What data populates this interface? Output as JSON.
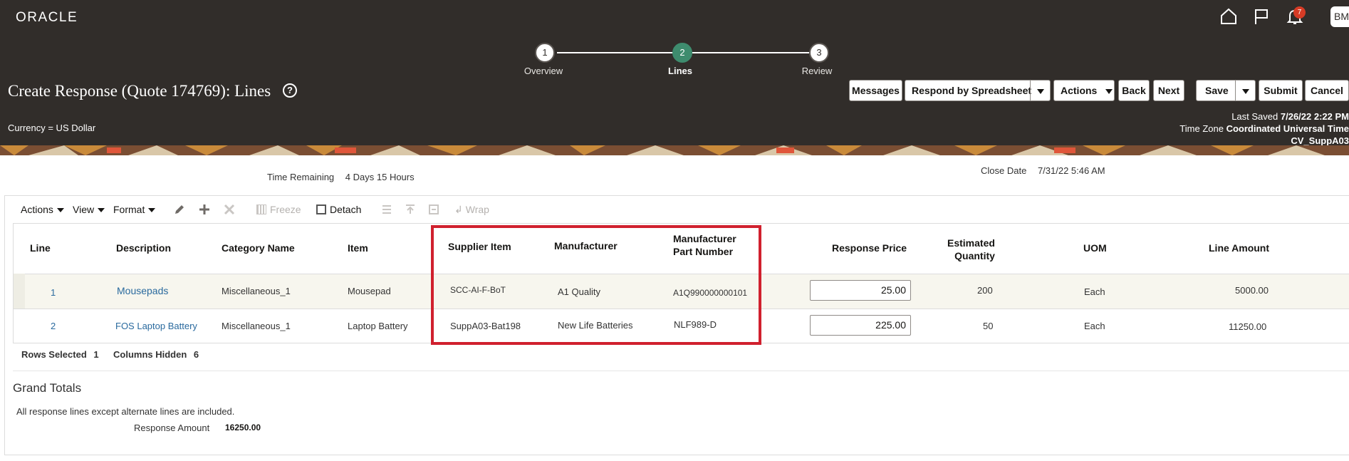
{
  "header": {
    "logo": "ORACLE",
    "notification_count": "7",
    "user_initials": "BM"
  },
  "stepper": [
    {
      "number": "1",
      "label": "Overview",
      "active": false
    },
    {
      "number": "2",
      "label": "Lines",
      "active": true
    },
    {
      "number": "3",
      "label": "Review",
      "active": false
    }
  ],
  "page": {
    "title": "Create Response (Quote 174769): Lines",
    "currency": "Currency = US Dollar"
  },
  "buttons": {
    "messages": "Messages",
    "respond_by_spreadsheet": "Respond by Spreadsheet",
    "actions": "Actions",
    "back": "Back",
    "next": "Next",
    "save": "Save",
    "submit": "Submit",
    "cancel": "Cancel"
  },
  "saved_info": {
    "last_saved_label": "Last Saved",
    "last_saved_value": "7/26/22 2:22 PM",
    "time_zone_label": "Time Zone",
    "time_zone_value": "Coordinated Universal Time",
    "supplier": "CV_SuppA03"
  },
  "info": {
    "time_remaining_label": "Time Remaining",
    "time_remaining_value": "4 Days 15 Hours",
    "close_date_label": "Close Date",
    "close_date_value": "7/31/22 5:46 AM"
  },
  "toolbar": {
    "actions": "Actions",
    "view": "View",
    "format": "Format",
    "freeze": "Freeze",
    "detach": "Detach",
    "wrap": "Wrap"
  },
  "table": {
    "headers": {
      "line": "Line",
      "description": "Description",
      "category": "Category Name",
      "item": "Item",
      "supplier_item": "Supplier Item",
      "manufacturer": "Manufacturer",
      "mfr_part_1": "Manufacturer",
      "mfr_part_2": "Part Number",
      "response_price": "Response Price",
      "est_qty_1": "Estimated",
      "est_qty_2": "Quantity",
      "uom": "UOM",
      "line_amount": "Line Amount"
    },
    "rows": [
      {
        "line": "1",
        "description": "Mousepads",
        "category": "Miscellaneous_1",
        "item": "Mousepad",
        "supplier_item": "SCC-AI-F-BoT",
        "manufacturer": "A1 Quality",
        "mfr_part": "A1Q990000000101",
        "response_price": "25.00",
        "est_qty": "200",
        "uom": "Each",
        "line_amount": "5000.00"
      },
      {
        "line": "2",
        "description": "FOS Laptop Battery",
        "category": "Miscellaneous_1",
        "item": "Laptop Battery",
        "supplier_item": "SuppA03-Bat198",
        "manufacturer": "New Life Batteries",
        "mfr_part": "NLF989-D",
        "response_price": "225.00",
        "est_qty": "50",
        "uom": "Each",
        "line_amount": "11250.00"
      }
    ]
  },
  "table_footer": {
    "rows_selected_label": "Rows Selected",
    "rows_selected_value": "1",
    "columns_hidden_label": "Columns Hidden",
    "columns_hidden_value": "6"
  },
  "grand_totals": {
    "title": "Grand Totals",
    "note": "All response lines except alternate lines are included.",
    "response_amount_label": "Response Amount",
    "response_amount_value": "16250.00"
  },
  "colors": {
    "header_bg": "#312d2a",
    "active_step": "#3e8c6e",
    "highlight": "#d0202e",
    "link": "#2a6a9e"
  }
}
